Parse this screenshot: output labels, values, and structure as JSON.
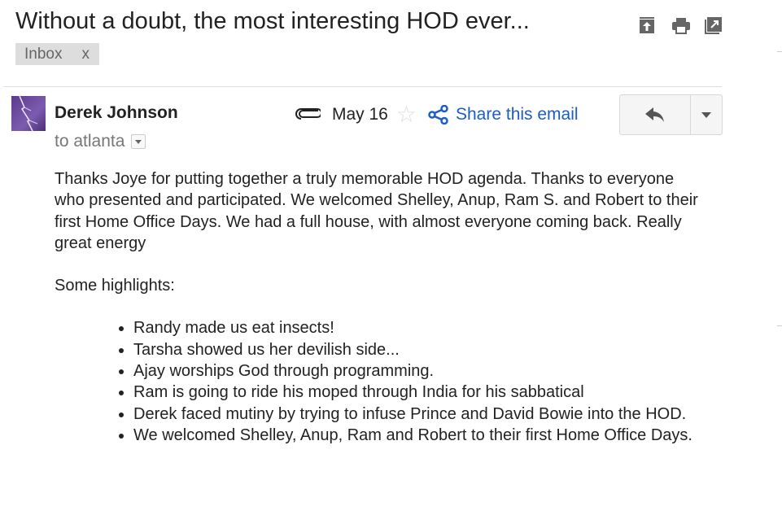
{
  "subject": "Without a doubt, the most interesting HOD ever...",
  "label": {
    "name": "Inbox",
    "remove": "x"
  },
  "toolbar": {
    "icons": [
      "archive-icon",
      "print-icon",
      "new-window-icon"
    ]
  },
  "message": {
    "sender": "Derek Johnson",
    "recipient": "to atlanta",
    "date": "May 16",
    "share_label": "Share this email",
    "paragraphs": [
      "Thanks Joye for putting together a truly memorable HOD agenda.  Thanks to everyone who presented and participated.  We welcomed Shelley, Anup, Ram S. and Robert to their first Home Office Days. We had a full house, with almost everyone coming back.  Really great energy",
      "Some highlights:"
    ],
    "highlights": [
      "Randy made us eat insects!",
      "Tarsha showed us her devilish side...",
      "Ajay worships God through programming.",
      "Ram is going to ride his moped through India for his sabbatical",
      "Derek faced mutiny by trying to infuse Prince and David Bowie into the HOD.",
      "We welcomed Shelley, Anup, Ram  and Robert to their first Home Office Days."
    ]
  },
  "colors": {
    "link": "#1a5dc9",
    "label_bg": "#dddddd",
    "text": "#222222"
  }
}
